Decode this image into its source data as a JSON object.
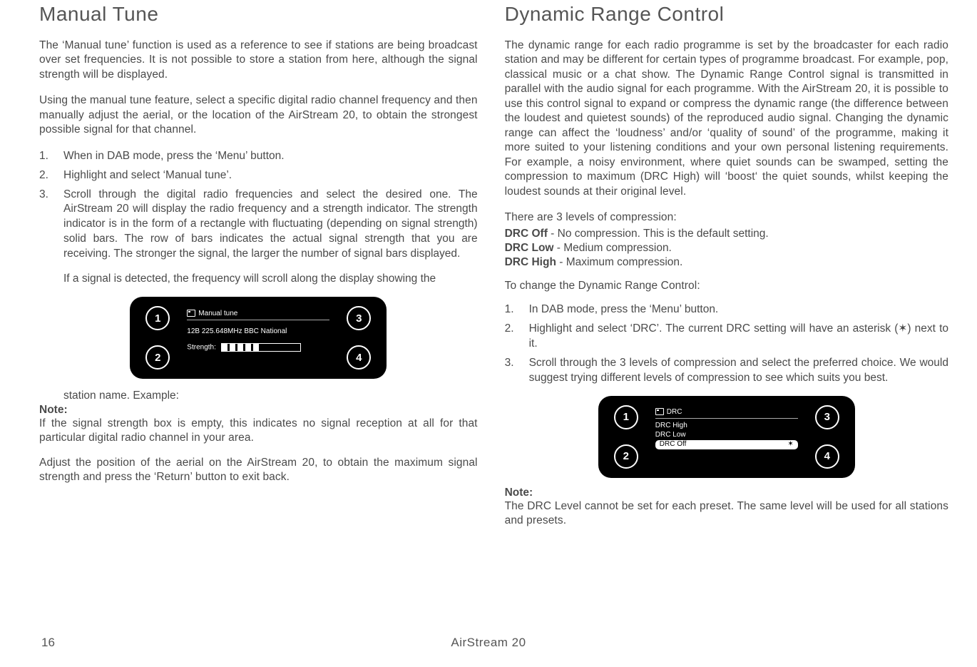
{
  "footer": {
    "page_number": "16",
    "product": "AirStream 20"
  },
  "left": {
    "heading": "Manual Tune",
    "p1": "The ‘Manual tune’ function is used as a reference to see if stations are being broadcast over set frequencies.  It is not possible to store a station from here, although the signal strength will be displayed.",
    "p2": "Using the manual tune feature, select a specific digital radio channel frequency and then manually adjust the aerial, or the location of the AirStream 20, to obtain the strongest possible signal for that channel.",
    "ol1": "When in DAB mode, press the ‘Menu’ button.",
    "ol2": "Highlight and select ‘Manual tune’.",
    "ol3": "Scroll through the digital radio frequencies and select the desired one.  The AirStream 20 will display the radio frequency and a strength indicator.  The strength indicator is in the form of a rectangle with fluctuating (depending on signal strength) solid bars. The row of bars indicates the actual signal strength that you are receiving. The stronger the signal, the larger the number of signal bars displayed.",
    "ol3b": "If a signal is detected, the frequency will scroll along the display showing the station name.  Example:",
    "device": {
      "title": "Manual tune",
      "freq": "12B 225.648MHz  BBC National",
      "strength_label": "Strength:",
      "btn1": "1",
      "btn2": "2",
      "btn3": "3",
      "btn4": "4"
    },
    "note_label": "Note:",
    "note_body": "If the signal strength box is empty, this indicates no signal reception at all for that particular digital radio channel in your area.",
    "p3": "Adjust the position of the aerial on the AirStream 20, to obtain the maximum signal strength and press the ‘Return’ button to exit back."
  },
  "right": {
    "heading": "Dynamic Range Control",
    "p1": "The dynamic range for each radio programme is set by the broadcaster for each radio station and may be different for certain types of programme broadcast.  For example, pop, classical music or a chat show. The Dynamic Range Control signal is transmitted in parallel with the audio signal for each programme.  With the AirStream 20, it is possible to use this control signal to expand or compress the dynamic range (the difference between the loudest and quietest sounds) of the reproduced audio signal. Changing the dynamic range can affect the ‘loudness’ and/or ‘quality of sound’ of the programme, making it more suited to your listening conditions and your own personal listening requirements.  For example, a noisy environment, where quiet sounds can be swamped, setting the compression to maximum (DRC High) will ‘boost‘ the quiet sounds, whilst keeping the loudest sounds at their original level.",
    "levels_intro": "There are 3 levels of compression:",
    "drc_off_label": "DRC Off",
    "drc_off_text": " - No compression. This is the default setting.",
    "drc_low_label": "DRC Low",
    "drc_low_text": " - Medium compression.",
    "drc_high_label": "DRC High",
    "drc_high_text": " - Maximum compression.",
    "change_intro": "To change the Dynamic Range Control:",
    "ol1": "In DAB mode, press the ‘Menu’ button.",
    "ol2": "Highlight and select ‘DRC’. The current DRC setting will have an asterisk (    ) next to it.",
    "ol3": "Scroll through the 3 levels of compression and select the preferred choice.  We would suggest trying different levels of compression to see which suits you best.",
    "device": {
      "title": "DRC",
      "row1": "DRC High",
      "row2": "DRC Low",
      "row3": "DRC Off",
      "btn1": "1",
      "btn2": "2",
      "btn3": "3",
      "btn4": "4"
    },
    "note_label": "Note:",
    "note_body": "The DRC Level cannot be set for each preset.  The same level will be used for all stations and presets."
  }
}
